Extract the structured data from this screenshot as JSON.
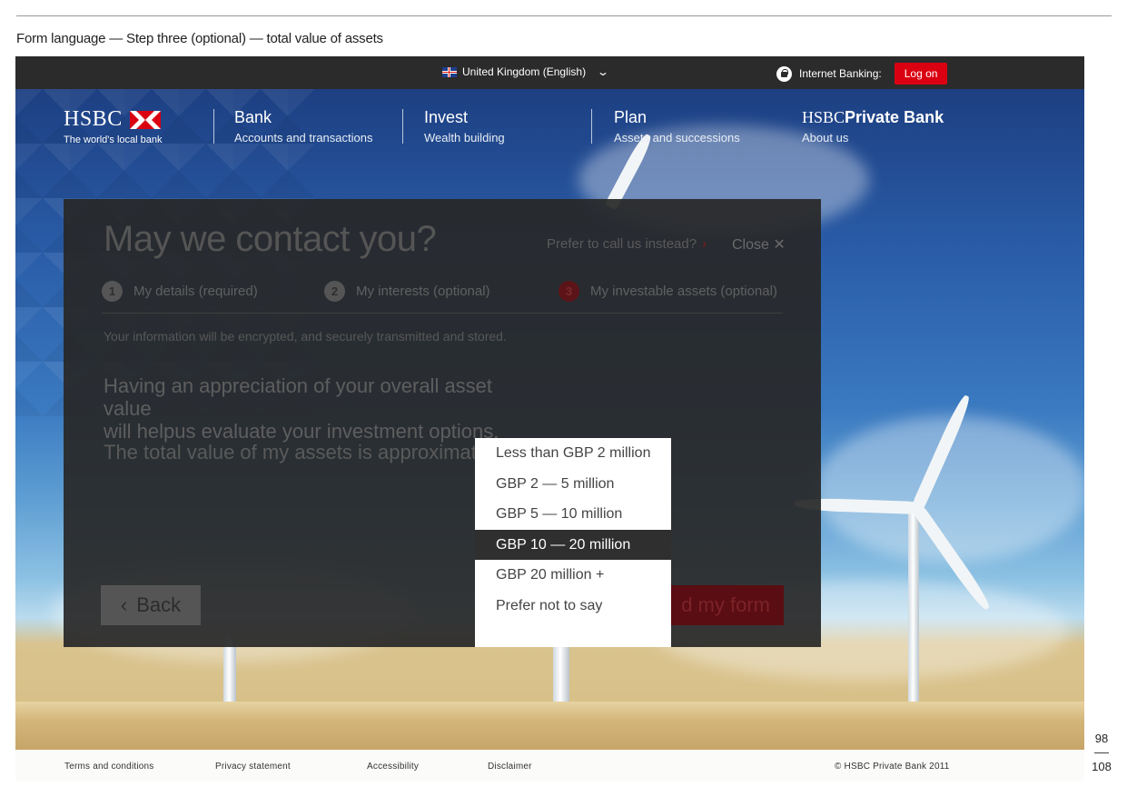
{
  "document": {
    "caption": "Form language — Step three (optional) — total value of assets",
    "page_current": "98",
    "page_total": "108"
  },
  "topbar": {
    "country_label": "United Kingdom (English)",
    "internet_banking_label": "Internet Banking:",
    "logon_label": "Log on"
  },
  "logo": {
    "wordmark": "HSBC",
    "tagline": "The world's local bank"
  },
  "nav": {
    "bank": {
      "title": "Bank",
      "sub": "Accounts and transactions"
    },
    "invest": {
      "title": "Invest",
      "sub": "Wealth building"
    },
    "plan": {
      "title": "Plan",
      "sub": "Assets and successions"
    },
    "private_bank": {
      "title_prefix": "HSBC",
      "title_bold": "Private Bank",
      "sub": "About us"
    }
  },
  "modal": {
    "title": "May we contact you?",
    "call_link": "Prefer to call us instead?",
    "close_label": "Close",
    "steps": [
      {
        "num": "1",
        "label": "My details (required)"
      },
      {
        "num": "2",
        "label": "My interests (optional)"
      },
      {
        "num": "3",
        "label": "My investable assets (optional)"
      }
    ],
    "encryption_note": "Your information will be encrypted, and securely transmitted and stored.",
    "question_line1": "Having an appreciation of your overall asset value",
    "question_line2": "will helpus evaluate your investment options.",
    "total_label": "The total value of my assets is approximately",
    "back_label": "Back",
    "send_label": "d my form"
  },
  "dropdown": {
    "options": [
      "Less than GBP 2 million",
      "GBP 2 — 5 million",
      "GBP 5 — 10 million",
      "GBP 10 — 20 million",
      "GBP 20 million +",
      "Prefer not to say"
    ],
    "selected": "GBP 10 — 20 million"
  },
  "footer": {
    "terms": "Terms and conditions",
    "privacy": "Privacy statement",
    "accessibility": "Accessibility",
    "disclaimer": "Disclaimer",
    "copyright": "© HSBC Private Bank 2011"
  },
  "colors": {
    "brand_red": "#db0011",
    "topbar": "#2b2b2b",
    "modal_bg": "#282828",
    "dropdown_selected": "#2f2f2f"
  }
}
